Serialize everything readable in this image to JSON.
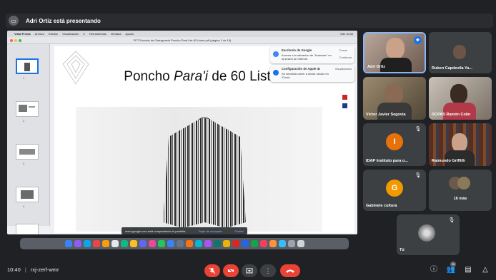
{
  "header": {
    "presenting_text": "Adri Ortiz está presentando"
  },
  "shared_screen": {
    "mac_menu": [
      "Vista Previa",
      "Archivo",
      "Edición",
      "Visualización",
      "Ir",
      "Herramientas",
      "Ventana",
      "Ayuda"
    ],
    "menu_right": "Mié 10:40",
    "window_title": "PPT Escuela de Galerguasla Poncho Para'i de 60 Listas.pdf (página 1 de 18)",
    "slide_title_pre": "Poncho ",
    "slide_title_italic": "Para'i",
    "slide_title_post": " de 60 Listas",
    "thumb_numbers": [
      "1",
      "2",
      "3",
      "4",
      "5"
    ],
    "notifications": [
      {
        "title": "Escritorio de Google",
        "body": "Acceso a la ubicación de \"Autorizar\" en la sesión de Internet.",
        "actions": [
          "Cerrar",
          "Continuar"
        ],
        "icon_color": "#4285f4"
      },
      {
        "title": "Configuración de Apple ID",
        "body": "Se necesita volver a iniciar sesión en iCloud.",
        "actions": [
          "Visualización"
        ],
        "icon_color": "#1a73e8"
      }
    ],
    "share_banner": {
      "text": "meet.google.com está compartiendo tu pantalla.",
      "stop": "Dejar de compartir",
      "hide": "Ocultar"
    }
  },
  "participants": [
    {
      "name": "Adri Ortiz",
      "type": "video",
      "speaking": true
    },
    {
      "name": "Ruben Capdevila Ya...",
      "type": "video"
    },
    {
      "name": "Victor Javier Segovia",
      "type": "video"
    },
    {
      "name": "DCPAS Ramón Colin",
      "type": "video"
    },
    {
      "name": "IDAP Instituto para o...",
      "type": "avatar",
      "initial": "I",
      "color": "#e8710a",
      "muted": true
    },
    {
      "name": "Raimundo Griffith",
      "type": "video"
    },
    {
      "name": "Gabinete cultura",
      "type": "avatar",
      "initial": "G",
      "color": "#f29900",
      "muted": true
    },
    {
      "name": "16 más",
      "type": "more"
    },
    {
      "name": "Tú",
      "type": "self",
      "muted": true
    }
  ],
  "bottom": {
    "time": "10:40",
    "separator": "|",
    "meeting_code": "rxj-zerf-wmr",
    "participant_count": "26"
  },
  "colors": {
    "background": "#202124",
    "tile": "#3c4043",
    "danger": "#ea4335",
    "accent": "#1a73e8"
  }
}
